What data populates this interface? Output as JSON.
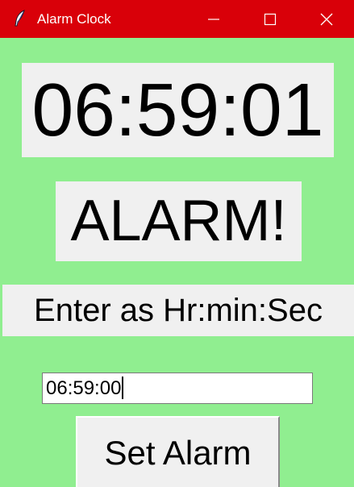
{
  "window": {
    "title": "Alarm Clock",
    "background_color": "#90ee90",
    "titlebar_color": "#d90009",
    "controls": [
      "minimize-icon",
      "maximize-icon",
      "close-icon"
    ]
  },
  "clock": {
    "time": "06:59:01"
  },
  "alarm": {
    "status": "ALARM!"
  },
  "instruction": {
    "text": "Enter as Hr:min:Sec"
  },
  "entry": {
    "value": "06:59:00"
  },
  "buttons": {
    "set_alarm": "Set Alarm"
  }
}
